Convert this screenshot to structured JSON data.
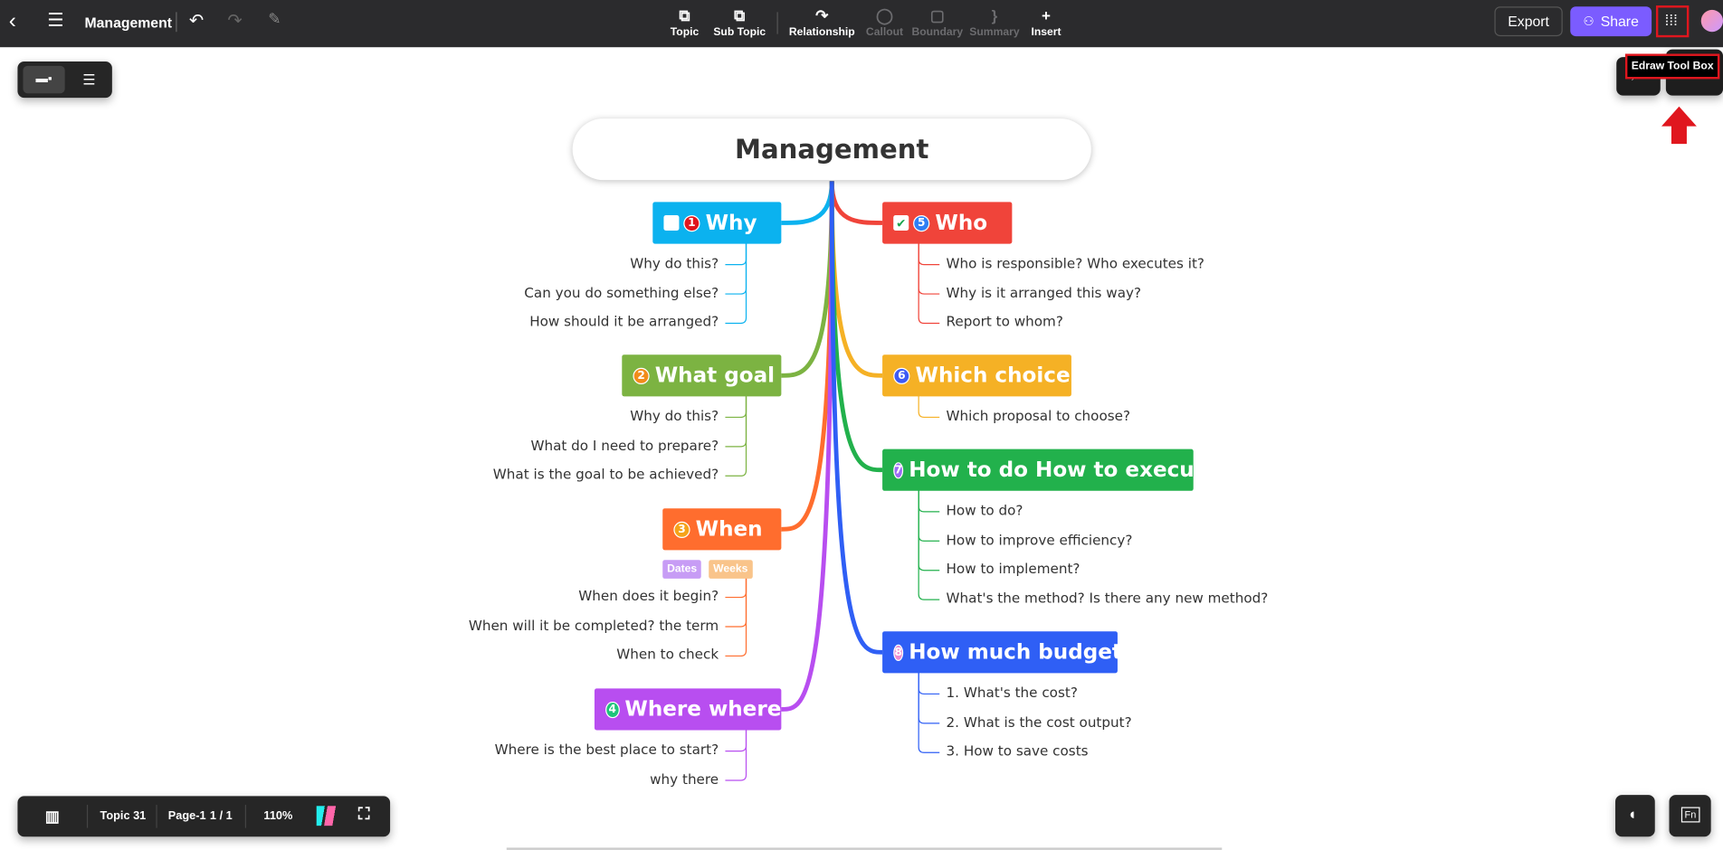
{
  "header": {
    "title": "Management",
    "tools": [
      {
        "label": "Topic",
        "enabled": true
      },
      {
        "label": "Sub Topic",
        "enabled": true
      },
      {
        "label": "Relationship",
        "enabled": true
      },
      {
        "label": "Callout",
        "enabled": false
      },
      {
        "label": "Boundary",
        "enabled": false
      },
      {
        "label": "Summary",
        "enabled": false
      },
      {
        "label": "Insert",
        "enabled": true
      }
    ],
    "export": "Export",
    "share": "Share"
  },
  "tooltip": "Edraw Tool Box",
  "map": {
    "root": "Management",
    "left": [
      {
        "label": "Why",
        "num": "1",
        "color": "#0bb2ef",
        "items": [
          "Why do this?",
          "Can you do something else?",
          "How should it be arranged?"
        ]
      },
      {
        "label": "What goal",
        "num": "2",
        "color": "#7cb342",
        "items": [
          "Why do this?",
          "What do I need to prepare?",
          "What is the goal to be achieved?"
        ]
      },
      {
        "label": "When",
        "num": "3",
        "color": "#ff6d2e",
        "tags": [
          "Dates",
          "Weeks"
        ],
        "items": [
          "When does it begin?",
          "When will it be completed? the term",
          "When to check"
        ]
      },
      {
        "label": "Where where",
        "num": "4",
        "color": "#b84ef0",
        "items": [
          "Where is the best place to start?",
          "why there"
        ]
      }
    ],
    "right": [
      {
        "label": "Who",
        "num": "5",
        "color": "#f0443a",
        "items": [
          "Who is responsible? Who executes it?",
          "Why is it arranged this way?",
          "Report to whom?"
        ]
      },
      {
        "label": "Which choice",
        "num": "6",
        "color": "#f5b125",
        "items": [
          "Which proposal to choose?"
        ]
      },
      {
        "label": "How to do How to execute",
        "num": "7",
        "color": "#22b14c",
        "items": [
          "How to do?",
          "How to improve efficiency?",
          "How to implement?",
          "What's the method? Is there any new method?"
        ]
      },
      {
        "label": "How much budget",
        "num": "8",
        "color": "#2f5ff5",
        "items": [
          "1. What's the cost?",
          "2. What is the cost output?",
          "3. How to save costs"
        ]
      }
    ]
  },
  "status": {
    "topic": "Topic 31",
    "page": "Page-1",
    "pages": "1 / 1",
    "zoom": "110%"
  }
}
